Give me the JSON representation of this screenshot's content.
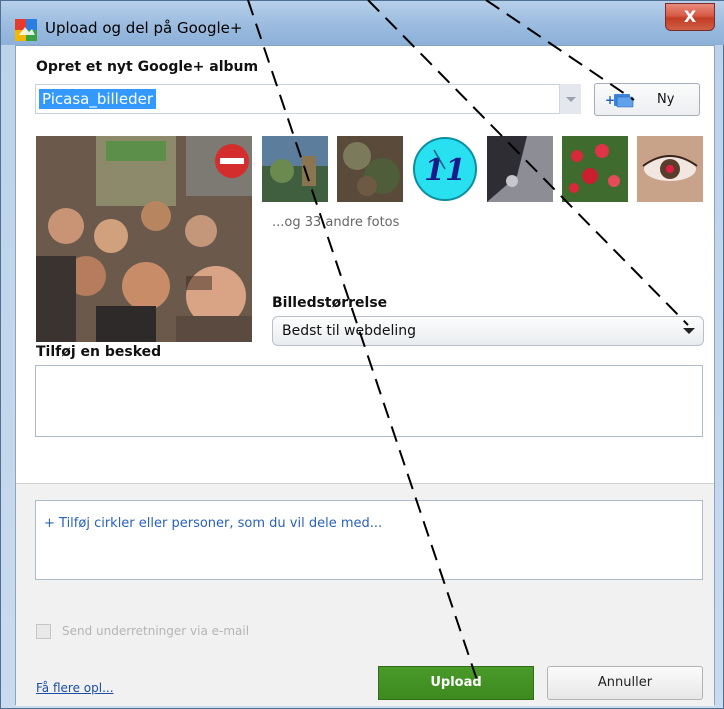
{
  "window": {
    "title": "Upload og del på Google+",
    "close_label": "X"
  },
  "album": {
    "heading": "Opret et nyt Google+ album",
    "name_value": "Picasa_billeder",
    "new_button_label": "Ny"
  },
  "photos": {
    "thumbnail_count": 6,
    "more_text": "...og 33 andre fotos"
  },
  "image_size": {
    "label": "Billedstørrelse",
    "selected": "Bedst til webdeling"
  },
  "message": {
    "label": "Tilføj en besked",
    "value": ""
  },
  "share": {
    "placeholder": "+ Tilføj cirkler eller personer, som du vil dele med..."
  },
  "email": {
    "label": "Send underretninger via e-mail",
    "checked": false,
    "enabled": false
  },
  "footer": {
    "more_link": "Få flere opl...",
    "upload_label": "Upload",
    "cancel_label": "Annuller"
  },
  "colors": {
    "upload_green": "#3d8a1f",
    "selection_blue": "#3399ff",
    "link_blue": "#1b4fa6",
    "close_red": "#c23c24"
  }
}
